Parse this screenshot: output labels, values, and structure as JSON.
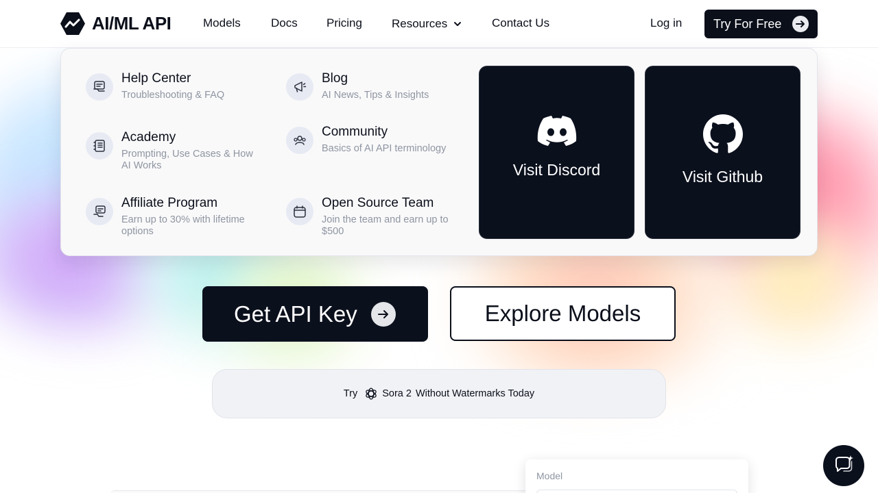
{
  "brand": {
    "name": "AI/ML API",
    "logo_icon": "trend-line-hexagon-icon"
  },
  "nav": {
    "models": "Models",
    "docs": "Docs",
    "pricing": "Pricing",
    "resources": "Resources",
    "contact": "Contact Us",
    "login": "Log in",
    "cta": "Try For Free"
  },
  "resources_menu": {
    "items": [
      {
        "title": "Help Center",
        "desc": "Troubleshooting & FAQ",
        "icon": "help-center-icon"
      },
      {
        "title": "Blog",
        "desc": "AI News, Tips & Insights",
        "icon": "megaphone-icon"
      },
      {
        "title": "Academy",
        "desc": "Prompting, Use Cases & How AI Works",
        "icon": "notebook-icon"
      },
      {
        "title": "Community",
        "desc": "Basics of AI API terminology",
        "icon": "community-icon"
      },
      {
        "title": "Affiliate Program",
        "desc": "Earn up to 30% with lifetime options",
        "icon": "affiliate-icon"
      },
      {
        "title": "Open Source Team",
        "desc": "Join the team and earn up to $500",
        "icon": "calendar-icon"
      }
    ],
    "cards": [
      {
        "label": "Visit Discord",
        "icon": "discord-icon"
      },
      {
        "label": "Visit Github",
        "icon": "github-icon"
      }
    ]
  },
  "hero": {
    "primary_cta": "Get API Key",
    "secondary_cta": "Explore Models"
  },
  "promo": {
    "prefix": "Try",
    "model": "Sora 2",
    "suffix": "Without Watermarks Today",
    "icon": "openai-icon"
  },
  "preview": {
    "model_label": "Model"
  },
  "colors": {
    "primary_dark": "#0b101d",
    "text_muted": "#8f95a1",
    "menu_bg": "#f9f9fa",
    "icon_circle": "#e7eaf3",
    "promo_bg": "#f1f2f6"
  }
}
